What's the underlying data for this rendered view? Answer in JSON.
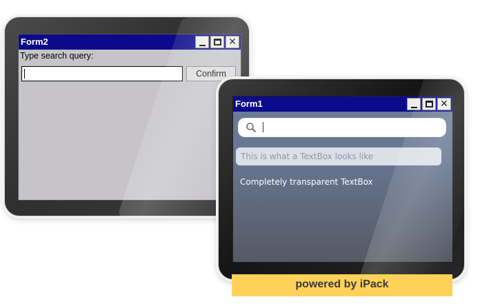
{
  "form2": {
    "title": "Form2",
    "label": "Type search query:",
    "input_value": "",
    "confirm_label": "Confirm"
  },
  "form1": {
    "title": "Form1",
    "search_value": "",
    "textbox_text": "This is what a TextBox looks like",
    "transparent_text": "Completely transparent TextBox"
  },
  "window_buttons": {
    "minimize": "minimize-icon",
    "maximize": "maximize-icon",
    "close": "close-icon",
    "close_glyph": "✕"
  },
  "banner": {
    "text": "powered by iPack",
    "color": "#ffd159"
  },
  "colors": {
    "titlebar": "#0a0a8a",
    "form2_bg": "#c6c4c9"
  }
}
